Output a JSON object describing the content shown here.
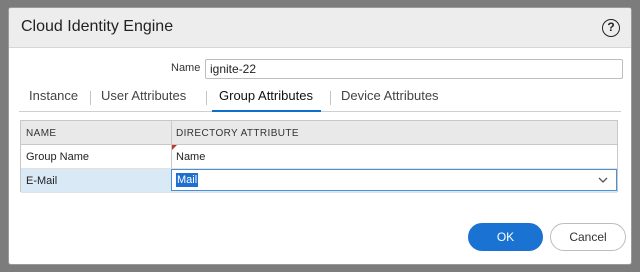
{
  "dialog": {
    "title": "Cloud Identity Engine",
    "help_icon": "help-icon",
    "help_glyph": "?"
  },
  "name_field": {
    "label": "Name",
    "value": "ignite-22"
  },
  "tabs": [
    {
      "label": "Instance",
      "active": false
    },
    {
      "label": "User Attributes",
      "active": false
    },
    {
      "label": "Group Attributes",
      "active": true
    },
    {
      "label": "Device Attributes",
      "active": false
    }
  ],
  "grid": {
    "columns": [
      "NAME",
      "DIRECTORY ATTRIBUTE"
    ],
    "rows": [
      {
        "name": "Group Name",
        "attribute": "Name"
      },
      {
        "name": "E-Mail",
        "attribute": "Mail",
        "selected": true
      }
    ]
  },
  "buttons": {
    "ok": "OK",
    "cancel": "Cancel"
  },
  "colors": {
    "accent": "#1a73d2",
    "selected_row": "#d9e9f6"
  }
}
